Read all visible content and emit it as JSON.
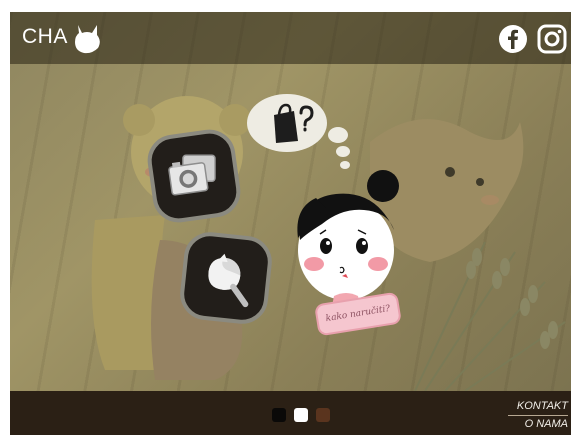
{
  "header": {
    "logo_text": "CHA",
    "logo_icon": "cat-head-icon",
    "social": [
      {
        "icon": "facebook-icon"
      },
      {
        "icon": "instagram-icon"
      }
    ]
  },
  "hero": {
    "background": "plush dolls on wooden planks",
    "menu_buttons": [
      {
        "icon": "photos-icon"
      },
      {
        "icon": "search-icon"
      }
    ],
    "thought_bubble": {
      "icon": "shopping-bag-question-icon"
    },
    "speech_bubble": {
      "text": "kako naručiti?"
    }
  },
  "footer": {
    "slider_dots": [
      {
        "color": "#0a0908",
        "active": false
      },
      {
        "color": "#ffffff",
        "active": true
      },
      {
        "color": "#5a341e",
        "active": false
      }
    ],
    "links": [
      {
        "label": "KONTAKT"
      },
      {
        "label": "O NAMA"
      }
    ]
  },
  "colors": {
    "header_overlay": "#28231480",
    "footer_bg": "#2b2015",
    "button_bg": "#221e1a",
    "speech_bg": "#f5c6cf"
  }
}
